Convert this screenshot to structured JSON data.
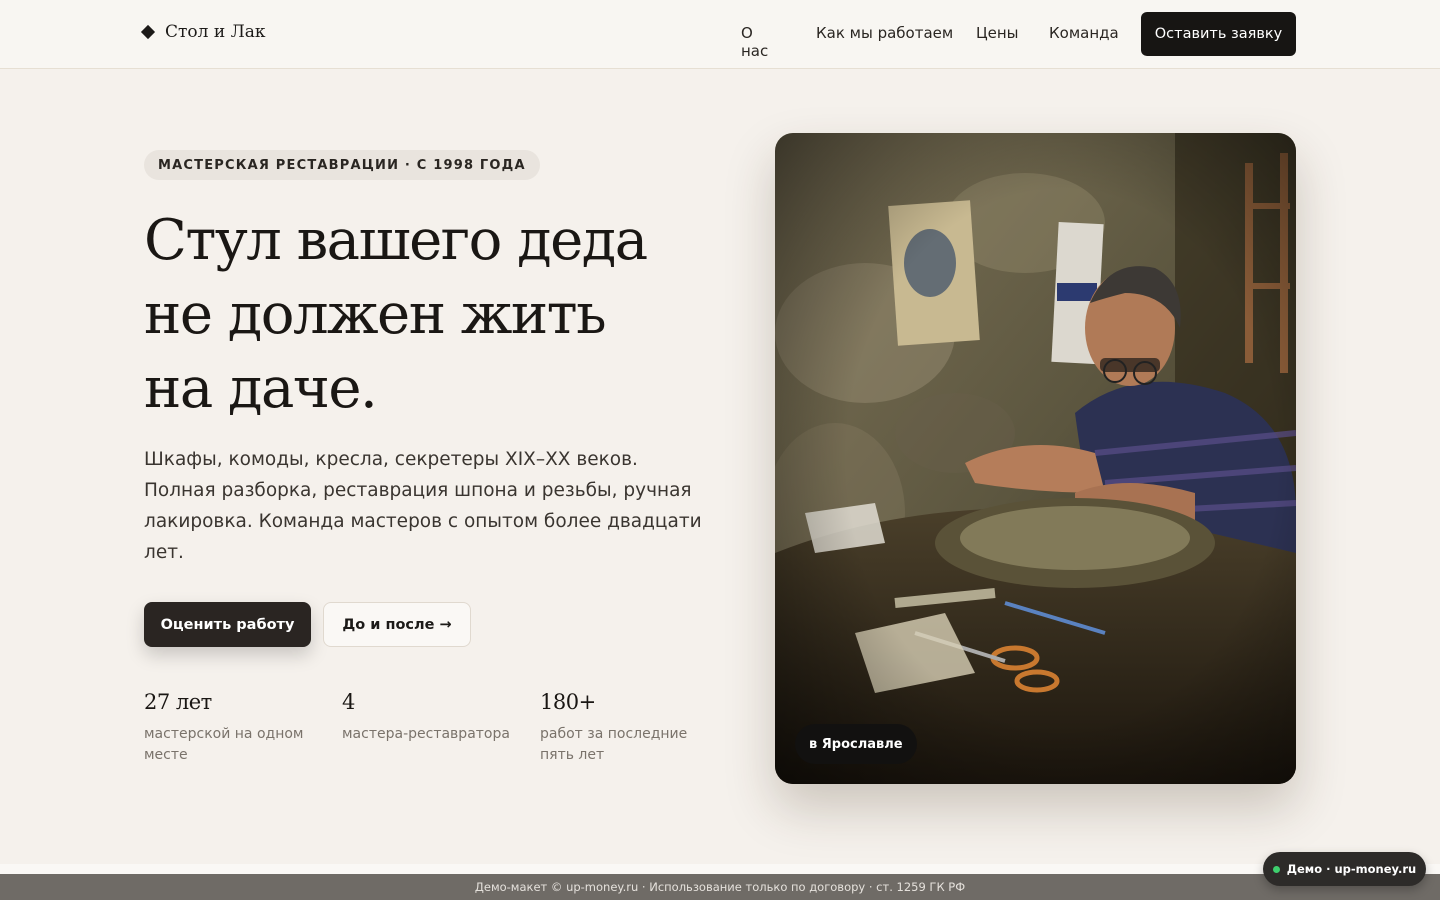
{
  "header": {
    "logo_text": "Стол и Лак",
    "logo_icon": "diamond-icon",
    "nav": [
      {
        "label": "О нас"
      },
      {
        "label": "Как мы работаем"
      },
      {
        "label": "Цены"
      },
      {
        "label": "Команда"
      }
    ],
    "cta_label": "Оставить заявку"
  },
  "hero": {
    "badge": "МАСТЕРСКАЯ РЕСТАВРАЦИИ · С 1998 ГОДА",
    "title_lines": [
      "Стул вашего деда",
      "не должен жить",
      "на даче."
    ],
    "description": "Шкафы, комоды, кресла, секретеры XIX–XX веков. Полная разборка, реставрация шпона и резьбы, ручная лакировка. Команда мастеров с опытом более двадцати лет.",
    "primary_button": "Оценить работу",
    "secondary_button": "До и после →",
    "stats": [
      {
        "value": "27 лет",
        "label": "мастерской на одном месте"
      },
      {
        "value": "4",
        "label": "мастера-реставратора"
      },
      {
        "value": "180+",
        "label": "работ за последние пять лет"
      }
    ],
    "photo_tag": "в Ярославле"
  },
  "footer": {
    "text": "Демо-макет © up-money.ru · Использование только по договору · ст. 1259 ГК РФ",
    "demo_pill": "Демо · up-money.ru"
  },
  "colors": {
    "background": "#f5f1ec",
    "dark_button": "#171513",
    "accent_green": "#3ecf6e"
  }
}
